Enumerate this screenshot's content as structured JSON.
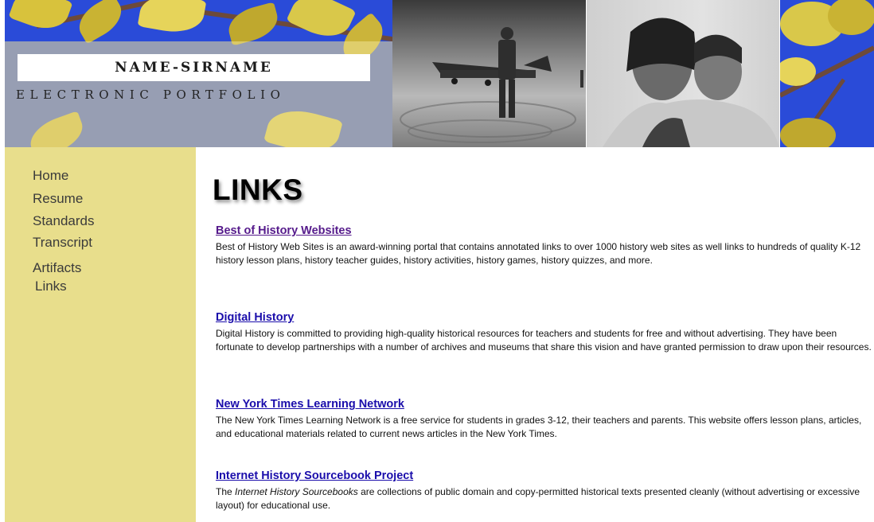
{
  "header": {
    "name": "NAME-SIRNAME",
    "subtitle": "ELECTRONIC PORTFOLIO"
  },
  "nav": {
    "items": [
      {
        "label": "Home"
      },
      {
        "label": "Resume"
      },
      {
        "label": "Standards"
      },
      {
        "label": "Transcript"
      },
      {
        "label": "Artifacts"
      },
      {
        "label": "Links"
      }
    ]
  },
  "main": {
    "title": "LINKS",
    "entries": [
      {
        "link": "Best of History Websites",
        "description": "Best of History Web Sites is an award-winning portal that contains annotated links to over 1000 history web sites as well links to hundreds of quality K-12 history lesson plans, history teacher guides, history activities, history games, history quizzes, and more."
      },
      {
        "link": "Digital History",
        "description": "Digital History is committed to providing high-quality historical resources for teachers and students for free and without advertising. They have been fortunate to develop partnerships with a number of archives and museums that share this vision and have granted permission to draw upon their resources."
      },
      {
        "link": "New York Times Learning Network",
        "description": "The New York Times Learning Network is a free service for students in grades 3-12, their teachers and parents. This website offers lesson plans, articles, and educational materials related to current news articles in the New York Times."
      },
      {
        "link": "Internet History Sourcebook Project",
        "description_prefix": "The ",
        "description_italic": "Internet History Sourcebooks",
        "description_suffix": " are collections of public domain and copy-permitted historical texts presented cleanly (without advertising or excessive layout) for educational use."
      }
    ]
  },
  "colors": {
    "sidebar_bg": "#e8de8c",
    "link_visited": "#551a8b",
    "link_unvisited": "#1a0dab",
    "sky_blue": "#2a4bd8"
  }
}
